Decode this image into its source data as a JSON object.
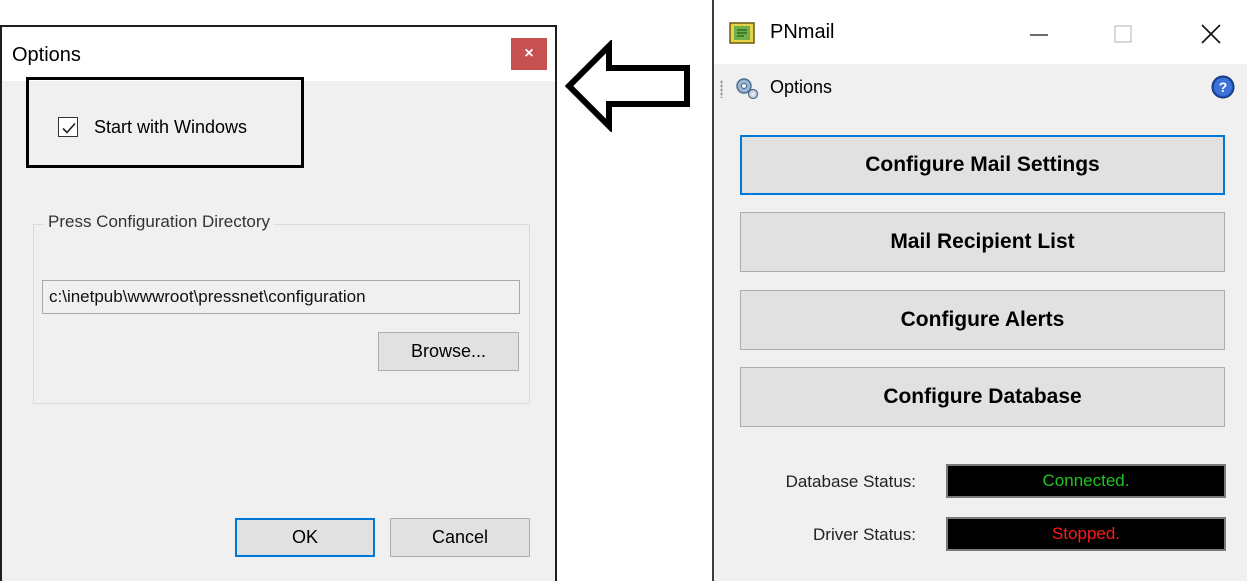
{
  "options_dialog": {
    "title": "Options",
    "close_glyph": "×",
    "start_with_windows": {
      "label": "Start with Windows",
      "checked": true
    },
    "directory_group": {
      "legend": "Press Configuration Directory",
      "path_value": "c:\\inetpub\\wwwroot\\pressnet\\configuration",
      "browse_label": "Browse..."
    },
    "ok_label": "OK",
    "cancel_label": "Cancel"
  },
  "pnmail_window": {
    "title": "PNmail",
    "toolbar": {
      "options_label": "Options"
    },
    "buttons": {
      "configure_mail_settings": "Configure Mail Settings",
      "mail_recipient_list": "Mail Recipient List",
      "configure_alerts": "Configure Alerts",
      "configure_database": "Configure Database"
    },
    "status": {
      "database_label": "Database Status:",
      "database_value": "Connected.",
      "database_color": "#22c322",
      "driver_label": "Driver Status:",
      "driver_value": "Stopped.",
      "driver_color": "#ff1a1a"
    }
  },
  "icons": {
    "app": "notebook-icon",
    "toolbar": "gear-icon",
    "help": "help-icon",
    "arrow": "left-arrow-icon"
  },
  "colors": {
    "accent_blue": "#0078d7",
    "dialog_close_red": "#c75050",
    "window_bg": "#f0f0f0"
  }
}
